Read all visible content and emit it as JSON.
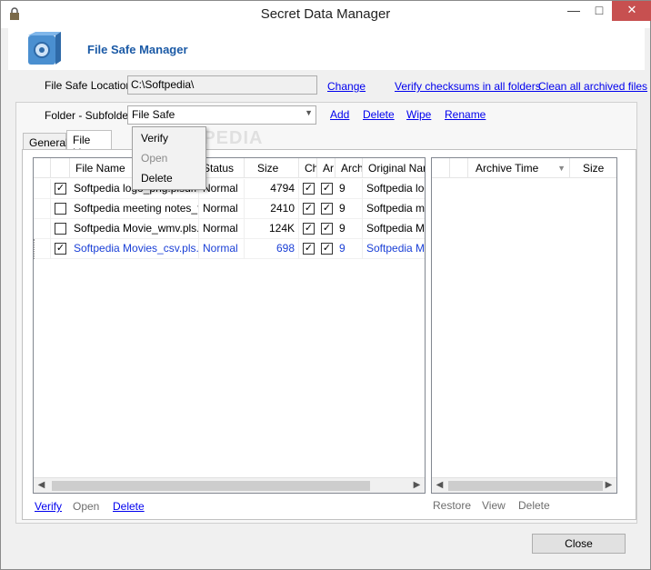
{
  "window": {
    "title": "Secret Data Manager"
  },
  "header": {
    "heading": "File Safe Manager"
  },
  "location": {
    "label": "File Safe Location",
    "value": "C:\\Softpedia\\",
    "change": "Change",
    "verify_all": "Verify checksums in all folders",
    "clean_all": "Clean all archived files"
  },
  "folder": {
    "label": "Folder - Subfolder",
    "selected": "File Safe",
    "add": "Add",
    "delete": "Delete",
    "wipe": "Wipe",
    "rename": "Rename"
  },
  "tabs": [
    "General",
    "File List"
  ],
  "file_list": {
    "columns": [
      "File Name",
      "Status",
      "Size",
      "Ch",
      "Ar",
      "Arch",
      "Original Name"
    ],
    "rows": [
      {
        "checked": true,
        "name": "Softpedia logo_png.plsdm",
        "status": "Normal",
        "size": "4794",
        "ch": true,
        "ar": true,
        "arch": "9",
        "original": "Softpedia logo"
      },
      {
        "checked": false,
        "name": "Softpedia meeting notes_t...",
        "status": "Normal",
        "size": "2410",
        "ch": true,
        "ar": true,
        "arch": "9",
        "original": "Softpedia meet"
      },
      {
        "checked": false,
        "name": "Softpedia Movie_wmv.pls...",
        "status": "Normal",
        "size": "124K",
        "ch": true,
        "ar": true,
        "arch": "9",
        "original": "Softpedia Mov"
      },
      {
        "checked": true,
        "name": "Softpedia Movies_csv.pls...",
        "status": "Normal",
        "size": "698",
        "ch": true,
        "ar": true,
        "arch": "9",
        "original": "Softpedia Mov"
      }
    ],
    "actions": {
      "verify": "Verify",
      "open": "Open",
      "delete": "Delete"
    }
  },
  "archive_list": {
    "columns": [
      "Archive Time",
      "Size"
    ],
    "actions": {
      "restore": "Restore",
      "view": "View",
      "delete": "Delete"
    }
  },
  "context_menu": {
    "items": [
      "Verify",
      "Open",
      "Delete"
    ]
  },
  "watermark": "SOFTPEDIA",
  "buttons": {
    "close": "Close"
  },
  "colors": {
    "link": "#0000ee",
    "heading": "#1b5aa6",
    "selected_row_text": "#1a3fd6"
  }
}
